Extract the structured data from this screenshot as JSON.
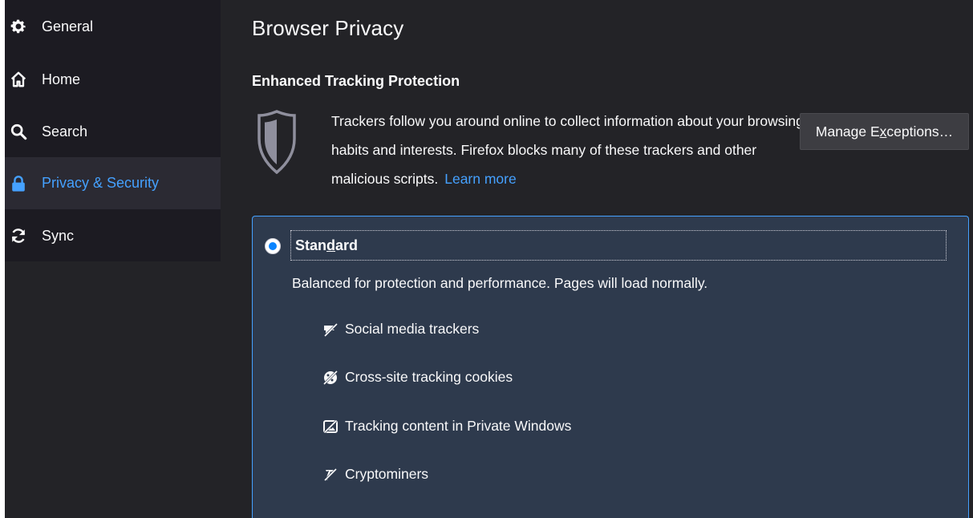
{
  "sidebar": {
    "items": [
      {
        "label": "General",
        "icon": "gear-icon"
      },
      {
        "label": "Home",
        "icon": "home-icon"
      },
      {
        "label": "Search",
        "icon": "search-icon"
      },
      {
        "label": "Privacy & Security",
        "icon": "lock-icon",
        "selected": true
      },
      {
        "label": "Sync",
        "icon": "sync-icon"
      }
    ]
  },
  "main": {
    "title": "Browser Privacy",
    "section_heading": "Enhanced Tracking Protection",
    "description": "Trackers follow you around online to collect information about your browsing habits and interests. Firefox blocks many of these trackers and other malicious scripts.",
    "learn_more": "Learn more",
    "manage_button": {
      "prefix": "Manage E",
      "access_key": "x",
      "suffix": "ceptions…"
    },
    "standard": {
      "label_prefix": "Stan",
      "label_access_key": "d",
      "label_suffix": "ard",
      "selected": true,
      "description": "Balanced for protection and performance. Pages will load normally.",
      "trackers": [
        {
          "label": "Social media trackers",
          "icon": "social-tracker-icon"
        },
        {
          "label": "Cross-site tracking cookies",
          "icon": "cookie-icon"
        },
        {
          "label": "Tracking content in Private Windows",
          "icon": "tracking-content-icon"
        },
        {
          "label": "Cryptominers",
          "icon": "cryptominer-icon"
        }
      ]
    }
  },
  "colors": {
    "background": "#232327",
    "accent": "#45a1ff",
    "card": "#2e3a4d",
    "button": "#3d3d42"
  }
}
